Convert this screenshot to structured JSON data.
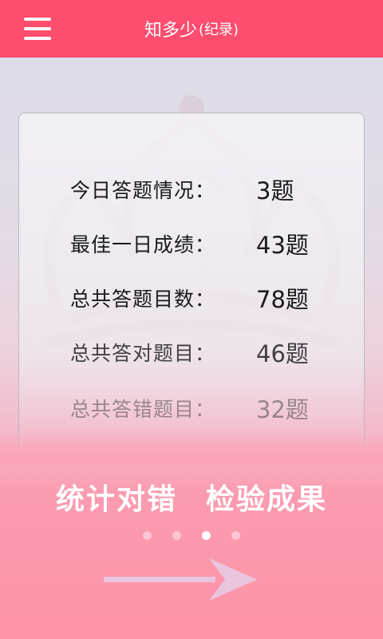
{
  "header": {
    "title_main": "知多少",
    "title_sub": "(纪录)",
    "menu_icon": "hamburger-menu-icon"
  },
  "stats": [
    {
      "label": "今日答题情况：",
      "value": "3题"
    },
    {
      "label": "最佳一日成绩：",
      "value": "43题"
    },
    {
      "label": "总共答题目数：",
      "value": "78题"
    },
    {
      "label": "总共答对题目：",
      "value": "46题"
    },
    {
      "label": "总共答错题目：",
      "value": "32题"
    }
  ],
  "slogan": {
    "part1": "统计对错",
    "part2": "检验成果"
  },
  "pager": {
    "total_pages": 4,
    "active_page": 3
  },
  "next_icon": "right-arrow-icon",
  "colors": {
    "header": "#fe4d6e",
    "accent_pink": "#fe94a8",
    "dot_inactive": "#fcc6d2",
    "dot_active": "#ffffff",
    "arrow": "#e9c6dd"
  }
}
